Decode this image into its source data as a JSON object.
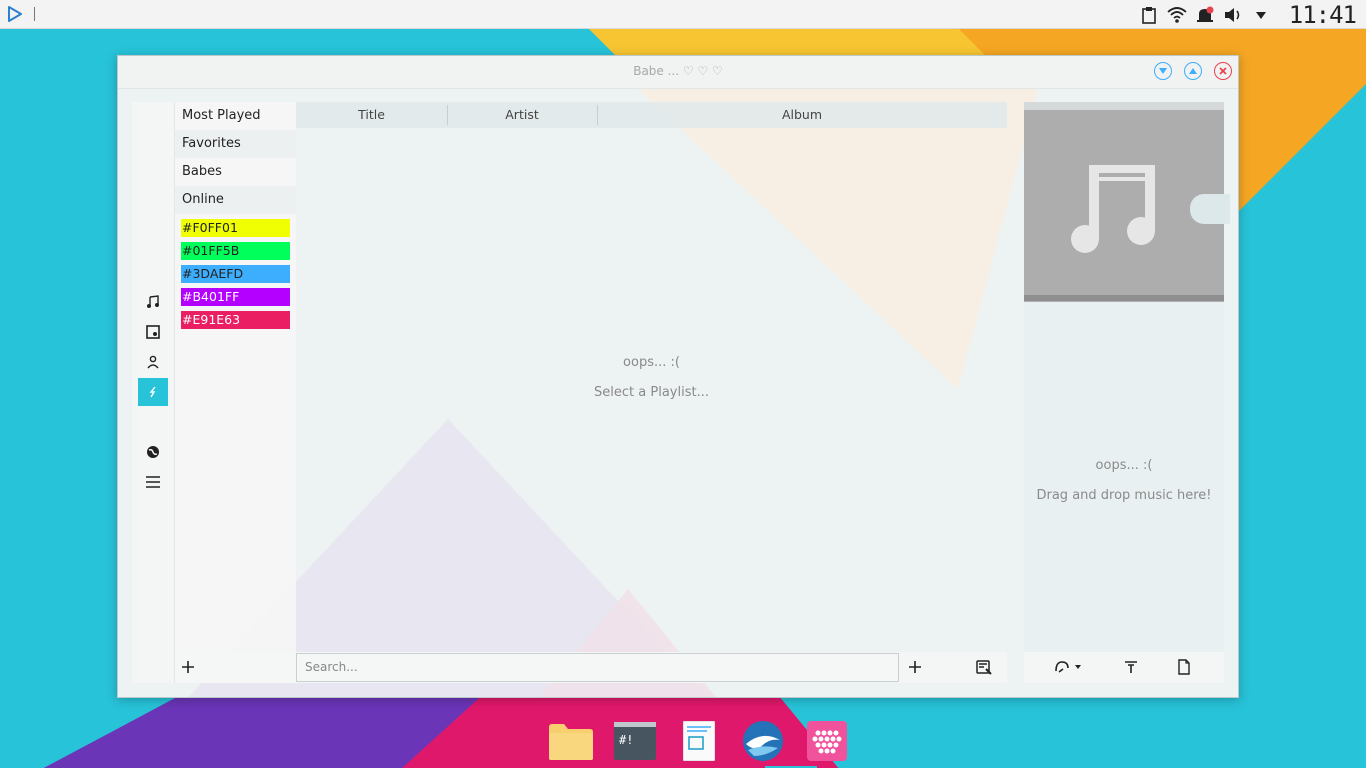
{
  "panel": {
    "clock": "11:41",
    "launcher_icon": "play-triangle-icon",
    "tray_icons": [
      "clipboard-icon",
      "wifi-icon",
      "notification-bell-icon",
      "volume-icon",
      "dropdown-arrow-icon"
    ]
  },
  "window": {
    "title": "Babe ... ♡ ♡ ♡",
    "buttons": [
      "minimize",
      "maximize",
      "close"
    ]
  },
  "sidebar_icons": [
    "music-note-icon",
    "album-icon",
    "artist-icon",
    "playlist-icon",
    "online-icon",
    "menu-icon"
  ],
  "playlists": {
    "items": [
      {
        "label": "Most Played"
      },
      {
        "label": "Favorites"
      },
      {
        "label": "Babes"
      },
      {
        "label": "Online"
      }
    ],
    "colors": [
      {
        "label": "#F0FF01",
        "color": "#F0FF01",
        "text": "#222222"
      },
      {
        "label": "#01FF5B",
        "color": "#01FF5B",
        "text": "#222222"
      },
      {
        "label": "#3DAEFD",
        "color": "#3DAEFD",
        "text": "#222222"
      },
      {
        "label": "#B401FF",
        "color": "#B401FF",
        "text": "#ffffff"
      },
      {
        "label": "#E91E63",
        "color": "#E91E63",
        "text": "#ffffff"
      }
    ]
  },
  "table": {
    "columns": [
      "Title",
      "Artist",
      "Album"
    ],
    "empty_title": "oops... :(",
    "empty_hint": "Select a Playlist..."
  },
  "search": {
    "placeholder": "Search..."
  },
  "right_panel": {
    "empty_title": "oops... :(",
    "empty_hint": "Drag and drop music here!"
  },
  "accent": "#27c3d9",
  "dock_apps": [
    "files-folder-icon",
    "terminal-icon",
    "text-editor-icon",
    "browser-icon",
    "music-player-icon"
  ]
}
